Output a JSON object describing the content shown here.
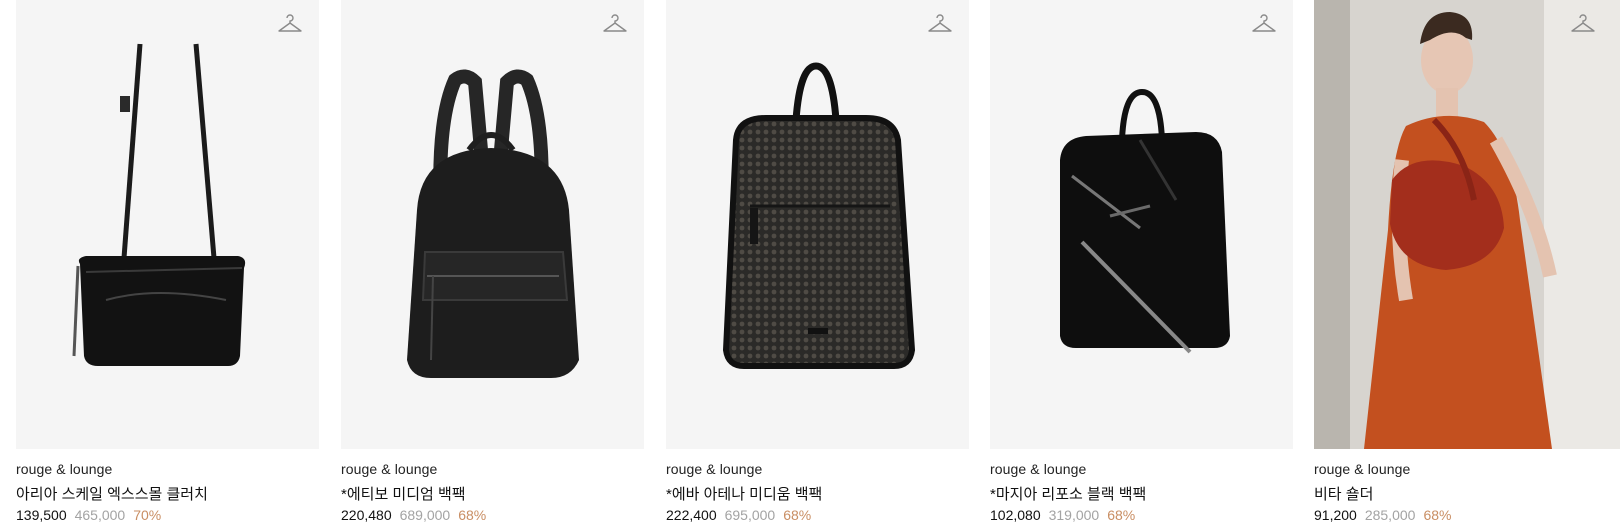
{
  "colors": {
    "discount": "#c98e63",
    "original_price": "#a3a3a3",
    "thumb_bg": "#f5f5f5"
  },
  "products": [
    {
      "brand": "rouge & lounge",
      "name": "아리아 스케일 엑스스몰 클러치",
      "price": "139,500",
      "original_price": "465,000",
      "discount": "70%",
      "icon": "hanger-icon"
    },
    {
      "brand": "rouge & lounge",
      "name": "*에티보 미디엄 백팩",
      "price": "220,480",
      "original_price": "689,000",
      "discount": "68%",
      "icon": "hanger-icon"
    },
    {
      "brand": "rouge & lounge",
      "name": "*에바 아테나 미디움 백팩",
      "price": "222,400",
      "original_price": "695,000",
      "discount": "68%",
      "icon": "hanger-icon"
    },
    {
      "brand": "rouge & lounge",
      "name": "*마지아 리포소 블랙 백팩",
      "price": "102,080",
      "original_price": "319,000",
      "discount": "68%",
      "icon": "hanger-icon"
    },
    {
      "brand": "rouge & lounge",
      "name": "비타 숄더",
      "price": "91,200",
      "original_price": "285,000",
      "discount": "68%",
      "icon": "hanger-icon"
    }
  ]
}
